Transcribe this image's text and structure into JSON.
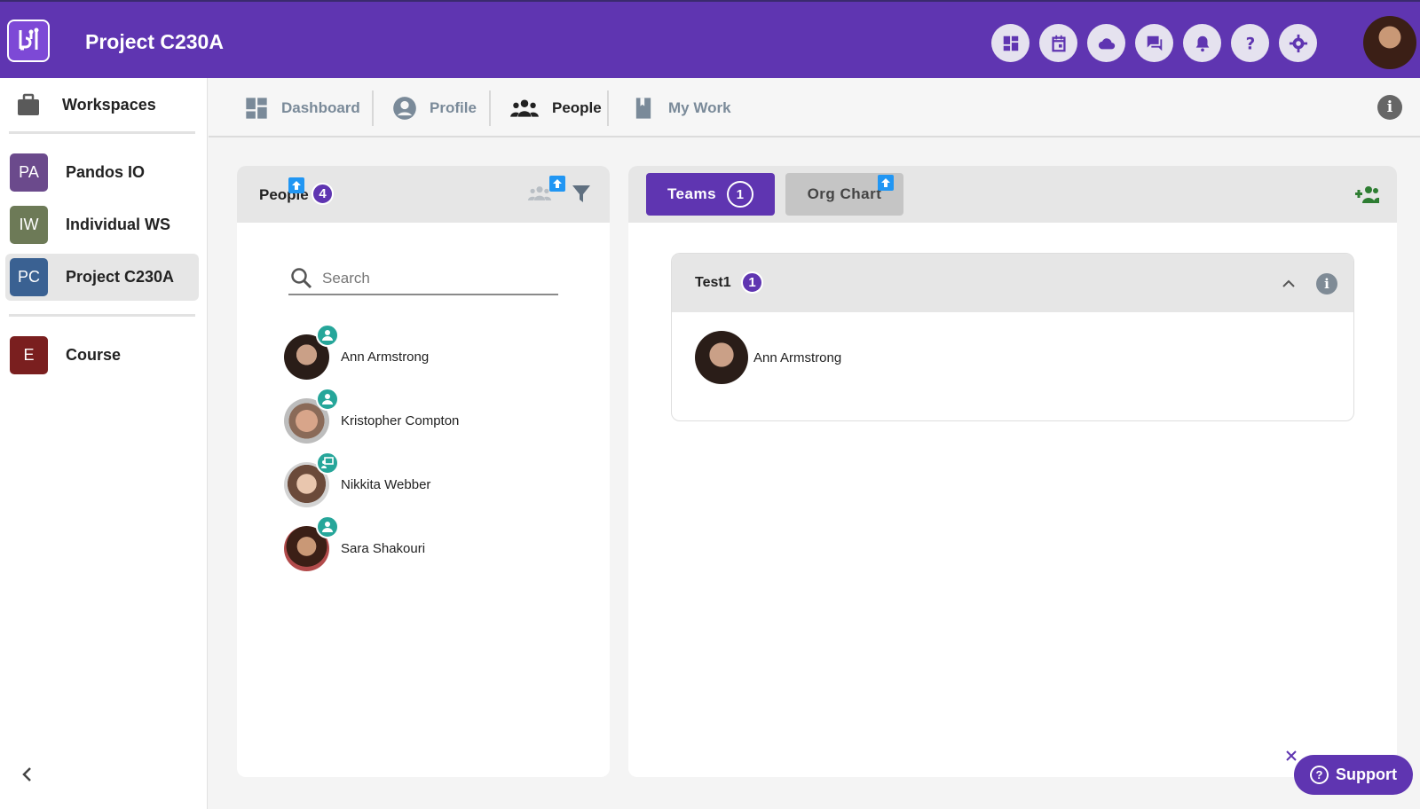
{
  "header": {
    "title": "Project C230A",
    "icons": [
      "dashboard-icon",
      "calendar-icon",
      "cloud-icon",
      "chat-icon",
      "bell-icon",
      "help-icon",
      "gear-icon"
    ]
  },
  "sidebar": {
    "workspaces_label": "Workspaces",
    "items": [
      {
        "initials": "PA",
        "name": "Pandos IO",
        "color": "#6b4a8c"
      },
      {
        "initials": "IW",
        "name": "Individual WS",
        "color": "#6d7a57"
      },
      {
        "initials": "PC",
        "name": "Project C230A",
        "color": "#3a6192",
        "active": true
      },
      {
        "initials": "E",
        "name": "Course",
        "color": "#7a1f1f"
      }
    ]
  },
  "nav": {
    "tabs": [
      {
        "label": "Dashboard",
        "icon": "dashboard-icon"
      },
      {
        "label": "Profile",
        "icon": "profile-icon"
      },
      {
        "label": "People",
        "icon": "people-icon",
        "active": true
      },
      {
        "label": "My Work",
        "icon": "book-icon"
      }
    ]
  },
  "people_panel": {
    "title": "People",
    "count": "4",
    "search_placeholder": "Search",
    "people": [
      {
        "name": "Ann Armstrong",
        "role_icon": "person-icon"
      },
      {
        "name": "Kristopher Compton",
        "role_icon": "person-icon"
      },
      {
        "name": "Nikkita Webber",
        "role_icon": "presenter-icon"
      },
      {
        "name": "Sara Shakouri",
        "role_icon": "person-icon"
      }
    ]
  },
  "teams_panel": {
    "teams_tab_label": "Teams",
    "teams_count": "1",
    "org_chart_label": "Org Chart",
    "team": {
      "name": "Test1",
      "count": "1",
      "members": [
        {
          "name": "Ann Armstrong"
        }
      ]
    }
  },
  "support": {
    "label": "Support"
  },
  "colors": {
    "brand": "#5f35b1",
    "role_badge": "#26a69a",
    "upload_tag": "#2196f3"
  }
}
